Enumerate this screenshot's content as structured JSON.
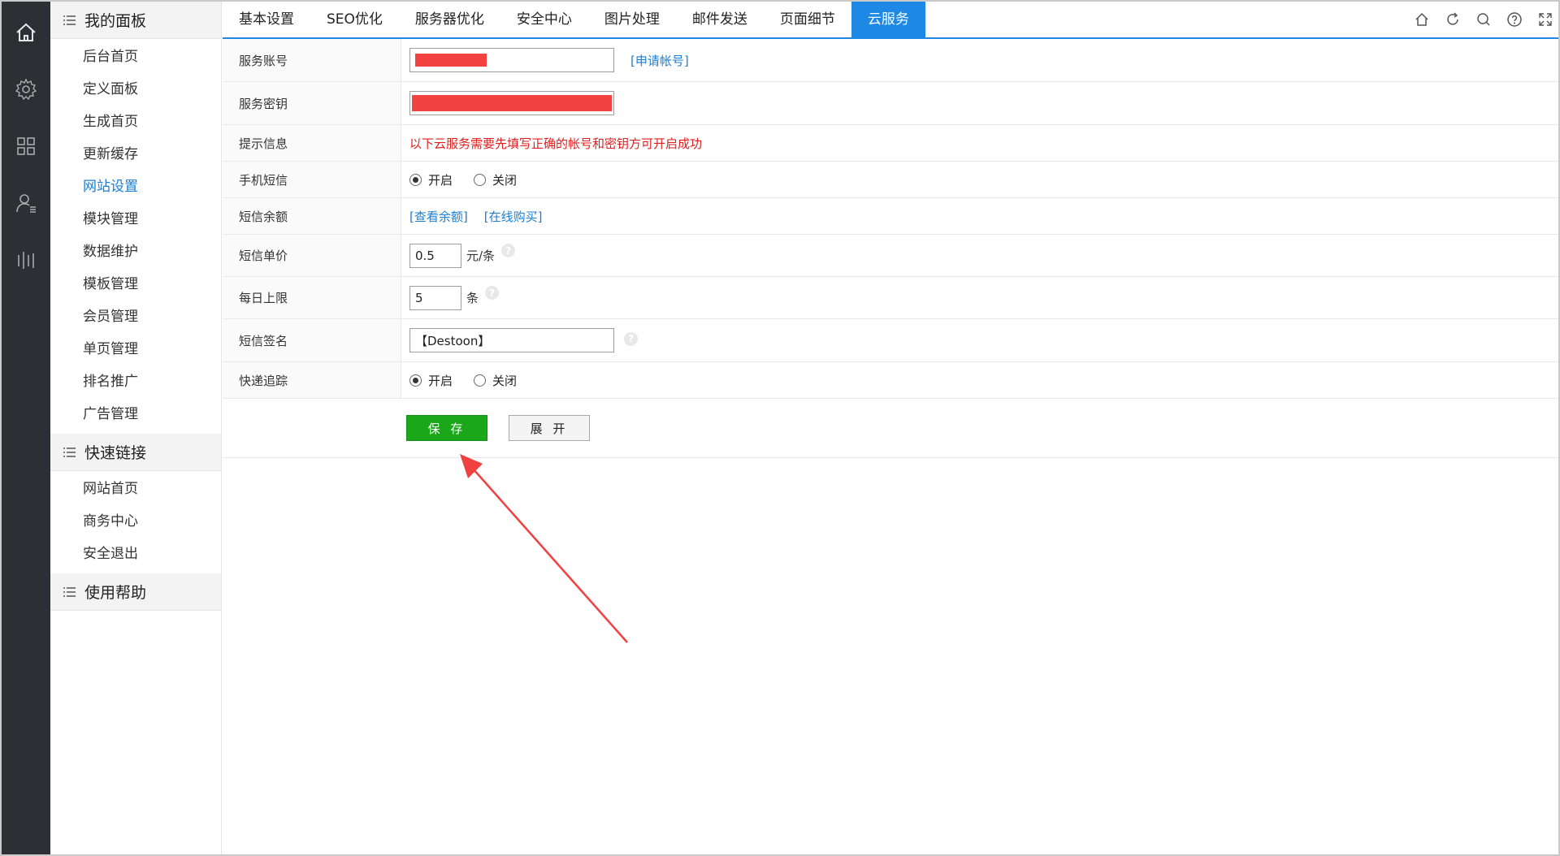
{
  "sidebar": {
    "groups": [
      {
        "title": "我的面板",
        "items": [
          {
            "label": "后台首页"
          },
          {
            "label": "定义面板"
          },
          {
            "label": "生成首页"
          },
          {
            "label": "更新缓存"
          },
          {
            "label": "网站设置",
            "active": true
          },
          {
            "label": "模块管理"
          },
          {
            "label": "数据维护"
          },
          {
            "label": "模板管理"
          },
          {
            "label": "会员管理"
          },
          {
            "label": "单页管理"
          },
          {
            "label": "排名推广"
          },
          {
            "label": "广告管理"
          }
        ]
      },
      {
        "title": "快速链接",
        "items": [
          {
            "label": "网站首页"
          },
          {
            "label": "商务中心"
          },
          {
            "label": "安全退出"
          }
        ]
      },
      {
        "title": "使用帮助",
        "items": []
      }
    ]
  },
  "rail": {
    "icons": [
      "home-icon",
      "gear-icon",
      "apps-grid-icon",
      "user-icon",
      "chart-bars-icon"
    ]
  },
  "tabs": [
    {
      "label": "基本设置"
    },
    {
      "label": "SEO优化"
    },
    {
      "label": "服务器优化"
    },
    {
      "label": "安全中心"
    },
    {
      "label": "图片处理"
    },
    {
      "label": "邮件发送"
    },
    {
      "label": "页面细节"
    },
    {
      "label": "云服务",
      "active": true
    }
  ],
  "toolbar_icons": [
    "home-icon",
    "refresh-icon",
    "search-icon",
    "help-icon",
    "fullscreen-icon"
  ],
  "form": {
    "account": {
      "label": "服务账号",
      "link": "[申请帐号]"
    },
    "secret": {
      "label": "服务密钥"
    },
    "tip": {
      "label": "提示信息",
      "text": "以下云服务需要先填写正确的帐号和密钥方可开启成功"
    },
    "sms": {
      "label": "手机短信",
      "on": "开启",
      "off": "关闭",
      "selected": "on"
    },
    "balance": {
      "label": "短信余额",
      "check": "[查看余额]",
      "buy": "[在线购买]"
    },
    "price": {
      "label": "短信单价",
      "value": "0.5",
      "unit": "元/条"
    },
    "limit": {
      "label": "每日上限",
      "value": "5",
      "unit": "条"
    },
    "sign": {
      "label": "短信签名",
      "value": "【Destoon】"
    },
    "express": {
      "label": "快递追踪",
      "on": "开启",
      "off": "关闭",
      "selected": "on"
    }
  },
  "buttons": {
    "save": "保 存",
    "expand": "展 开"
  },
  "colors": {
    "accent": "#1e88e5",
    "save": "#1aa81a",
    "redaction": "#f24242",
    "warning": "#e01e1e",
    "arrow": "#f04040"
  }
}
